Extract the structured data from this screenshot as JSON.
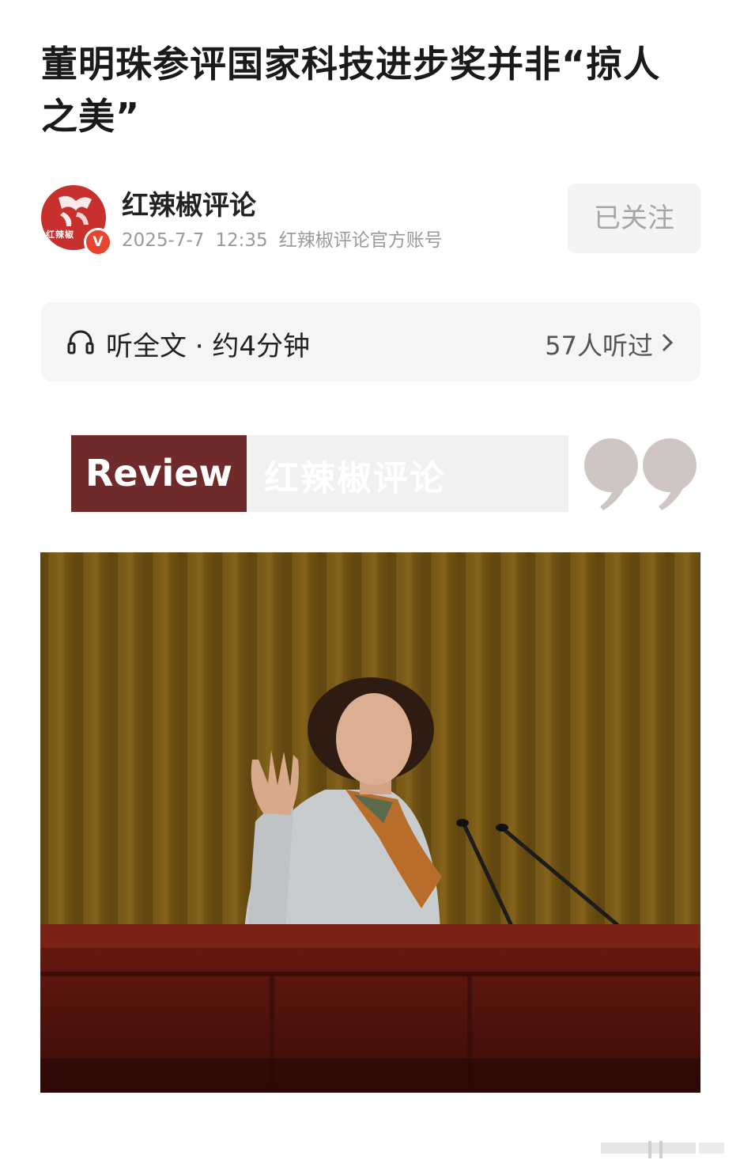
{
  "article": {
    "title": "董明珠参评国家科技进步奖并非“掠人之美”"
  },
  "author": {
    "name": "红辣椒评论",
    "avatar_text": "红辣椒",
    "verified_badge": "V",
    "date": "2025-7-7",
    "time": "12:35",
    "account_type": "红辣椒评论官方账号",
    "follow_label": "已关注"
  },
  "listen": {
    "icon": "headphone-icon",
    "label": "听全文 · 约4分钟",
    "count": "57人听过"
  },
  "banner": {
    "review_label": "Review",
    "review_sub": "红辣椒评论",
    "quote_icon": "quote-icon",
    "colors": {
      "review_bg": "#6f2b2c",
      "quote": "#cfc6c4"
    }
  },
  "photo": {
    "icon": "photo-of-speaker-at-podium"
  }
}
